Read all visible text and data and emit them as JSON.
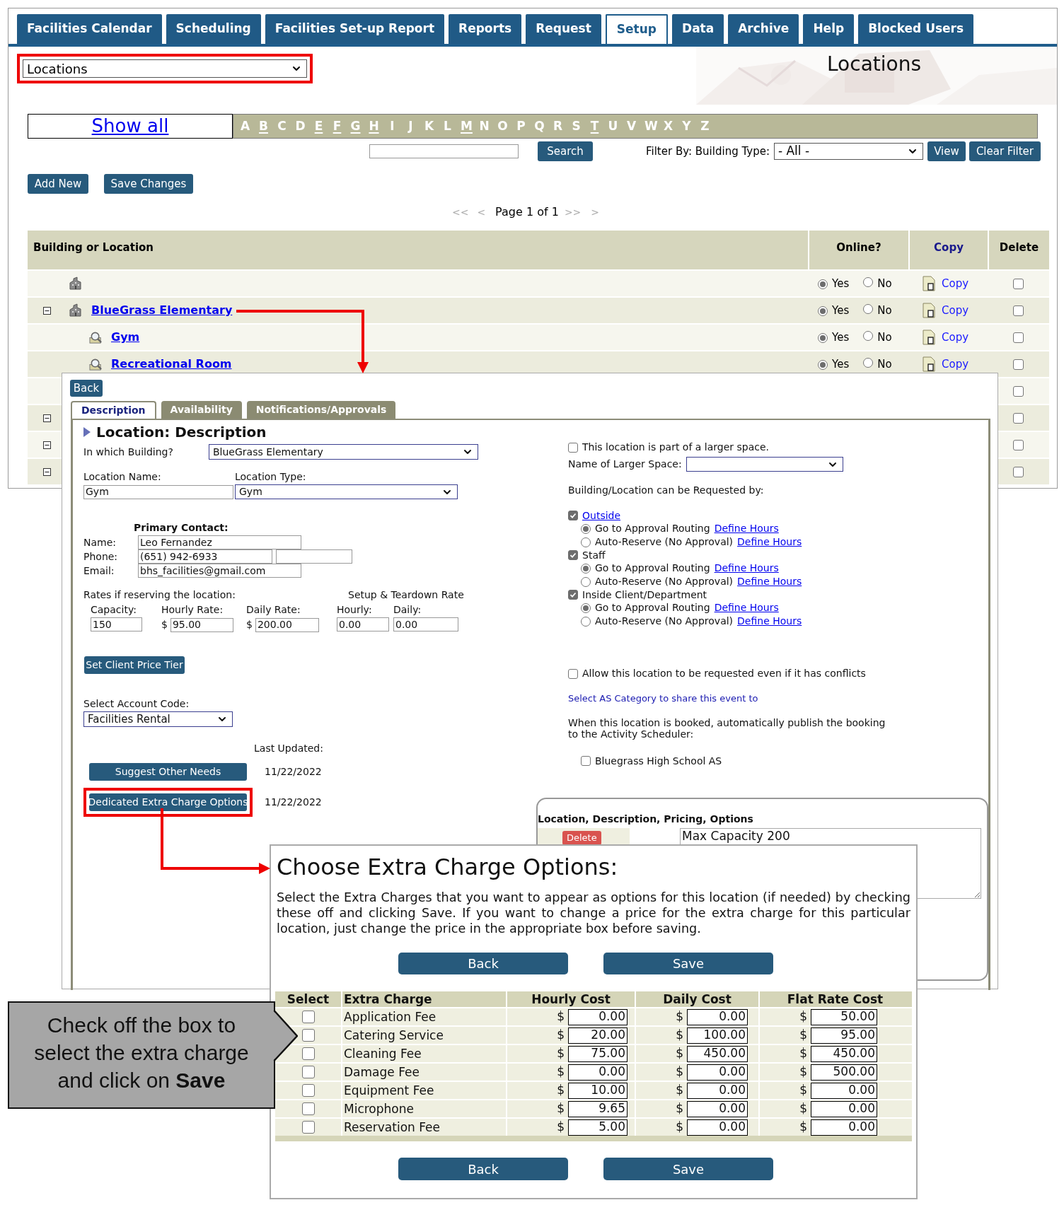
{
  "nav_tabs": [
    {
      "label": "Facilities Calendar",
      "selected": false
    },
    {
      "label": "Scheduling",
      "selected": false
    },
    {
      "label": "Facilities Set-up Report",
      "selected": false
    },
    {
      "label": "Reports",
      "selected": false
    },
    {
      "label": "Request",
      "selected": false
    },
    {
      "label": "Setup",
      "selected": true
    },
    {
      "label": "Data",
      "selected": false
    },
    {
      "label": "Archive",
      "selected": false
    },
    {
      "label": "Help",
      "selected": false
    },
    {
      "label": "Blocked Users",
      "selected": false
    }
  ],
  "view_select": {
    "value": "Locations",
    "highlighted": true
  },
  "page_title": "Locations",
  "show_all": "Show all",
  "letters": [
    {
      "letter": "A",
      "linked": false
    },
    {
      "letter": "B",
      "linked": true
    },
    {
      "letter": "C",
      "linked": false
    },
    {
      "letter": "D",
      "linked": false
    },
    {
      "letter": "E",
      "linked": true
    },
    {
      "letter": "F",
      "linked": true
    },
    {
      "letter": "G",
      "linked": true
    },
    {
      "letter": "H",
      "linked": true
    },
    {
      "letter": "I",
      "linked": false
    },
    {
      "letter": "J",
      "linked": false
    },
    {
      "letter": "K",
      "linked": false
    },
    {
      "letter": "L",
      "linked": false
    },
    {
      "letter": "M",
      "linked": true
    },
    {
      "letter": "N",
      "linked": false
    },
    {
      "letter": "O",
      "linked": false
    },
    {
      "letter": "P",
      "linked": false
    },
    {
      "letter": "Q",
      "linked": false
    },
    {
      "letter": "R",
      "linked": false
    },
    {
      "letter": "S",
      "linked": false
    },
    {
      "letter": "T",
      "linked": true
    },
    {
      "letter": "U",
      "linked": false
    },
    {
      "letter": "V",
      "linked": false
    },
    {
      "letter": "W",
      "linked": false
    },
    {
      "letter": "X",
      "linked": false
    },
    {
      "letter": "Y",
      "linked": false
    },
    {
      "letter": "Z",
      "linked": false
    }
  ],
  "search": {
    "button": "Search"
  },
  "filter": {
    "label": "Filter By: Building Type:",
    "value": "- All -",
    "view": "View",
    "clear": "Clear Filter"
  },
  "actions": [
    "Add New",
    "Save Changes"
  ],
  "pager": {
    "first": "<<",
    "prev": "<",
    "label": "Page 1 of 1",
    "next": ">>",
    "last": ">"
  },
  "table": {
    "columns": [
      "Building or Location",
      "Online?",
      "Copy",
      "Delete"
    ],
    "rows": [
      {
        "kind": "building",
        "expander": false,
        "online": true,
        "yes": "Yes",
        "no": "No",
        "copy": "Copy",
        "delete_checked": false
      },
      {
        "kind": "building",
        "expander": true,
        "name": "BlueGrass Elementary",
        "online": true,
        "yes": "Yes",
        "no": "No",
        "copy": "Copy",
        "delete_checked": false
      },
      {
        "kind": "room",
        "expander": false,
        "name": "Gym",
        "online": true,
        "yes": "Yes",
        "no": "No",
        "copy": "Copy",
        "delete_checked": false
      },
      {
        "kind": "room",
        "expander": false,
        "name": "Recreational Room",
        "online": true,
        "yes": "Yes",
        "no": "No",
        "copy": "Copy",
        "delete_checked": false
      },
      {
        "kind": "covered",
        "expander": false,
        "delete_checked": false
      },
      {
        "kind": "covered",
        "expander": true,
        "delete_checked": false
      },
      {
        "kind": "covered",
        "expander": true,
        "delete_checked": false
      },
      {
        "kind": "covered",
        "expander": true,
        "delete_checked": false
      }
    ]
  },
  "location_panel": {
    "back": "Back",
    "tabs": [
      {
        "label": "Description",
        "selected": true
      },
      {
        "label": "Availability",
        "selected": false
      },
      {
        "label": "Notifications/Approvals",
        "selected": false
      }
    ],
    "heading": "Location: Description",
    "building_label": "In which Building?",
    "building_value": "BlueGrass Elementary",
    "name_label": "Location Name:",
    "name_value": "Gym",
    "type_label": "Location Type:",
    "type_value": "Gym",
    "contact_heading": "Primary Contact:",
    "contact": [
      {
        "kind": "text",
        "label": "Name:",
        "value": "Leo Fernandez"
      },
      {
        "kind": "phone",
        "label": "Phone:",
        "value": "(651) 942-6933"
      },
      {
        "kind": "text",
        "label": "Email:",
        "value": "bhs_facilities@gmail.com"
      }
    ],
    "rates_label": "Rates if reserving the location:",
    "setup_label": "Setup & Teardown Rate",
    "rates": [
      {
        "label": "Capacity:",
        "value": "150"
      },
      {
        "label": "Hourly Rate:",
        "currency": "$",
        "value": "95.00"
      },
      {
        "label": "Daily Rate:",
        "currency": "$",
        "value": "200.00"
      },
      {
        "label": "Hourly:",
        "value": "0.00"
      },
      {
        "label": "Daily:",
        "value": "0.00"
      }
    ],
    "price_tier_button": "Set Client Price Tier",
    "account_label": "Select Account Code:",
    "account_value": "Facilities Rental",
    "last_updated_label": "Last Updated:",
    "option_buttons": [
      {
        "label": "Suggest Other Needs",
        "date": "11/22/2022",
        "highlighted": false
      },
      {
        "label": "Dedicated Extra Charge Options",
        "date": "11/22/2022",
        "highlighted": true
      }
    ],
    "larger_space": {
      "checked": false,
      "label": "This location is part of a larger space.",
      "name_label": "Name of Larger Space:"
    },
    "requested_by_label": "Building/Location can be Requested by:",
    "requesters": [
      {
        "label": "Outside",
        "link": true,
        "checked": true,
        "options": [
          {
            "label": "Go to Approval Routing",
            "link": "Define Hours",
            "selected": true
          },
          {
            "label": "Auto-Reserve (No Approval)",
            "link": "Define Hours",
            "selected": false
          }
        ]
      },
      {
        "label": "Staff",
        "link": false,
        "checked": true,
        "options": [
          {
            "label": "Go to Approval Routing",
            "link": "Define Hours",
            "selected": true
          },
          {
            "label": "Auto-Reserve (No Approval)",
            "link": "Define Hours",
            "selected": false
          }
        ]
      },
      {
        "label": "Inside Client/Department",
        "link": false,
        "checked": true,
        "options": [
          {
            "label": "Go to Approval Routing",
            "link": "Define Hours",
            "selected": true
          },
          {
            "label": "Auto-Reserve (No Approval)",
            "link": "Define Hours",
            "selected": false
          }
        ]
      }
    ],
    "allow_conflicts": {
      "checked": false,
      "label": "Allow this location to be requested even if it has conflicts"
    },
    "as_category_link": "Select AS Category to share this event to",
    "publish_text": "When this location is booked, automatically publish the booking to the Activity Scheduler:",
    "scheduler": {
      "checked": false,
      "label": "Bluegrass High School AS"
    },
    "options_box": {
      "title": "Location, Description, Pricing, Options",
      "delete": "Delete",
      "text": "Max Capacity 200"
    }
  },
  "extra_charges": {
    "title": "Choose Extra Charge Options:",
    "intro": "Select the Extra Charges that you want to appear as options for this location (if needed) by checking these off and clicking Save. If you want to change a price for the extra charge for this particular location, just change the price in the appropriate box before saving.",
    "top_buttons": [
      "Back",
      "Save"
    ],
    "columns": [
      "Select",
      "Extra Charge",
      "Hourly Cost",
      "Daily Cost",
      "Flat Rate Cost"
    ],
    "rows": [
      {
        "checked": false,
        "name": "Application Fee",
        "costs": [
          {
            "currency": "$",
            "value": "0.00"
          },
          {
            "currency": "$",
            "value": "0.00"
          },
          {
            "currency": "$",
            "value": "50.00"
          }
        ]
      },
      {
        "checked": false,
        "name": "Catering Service",
        "costs": [
          {
            "currency": "$",
            "value": "20.00"
          },
          {
            "currency": "$",
            "value": "100.00"
          },
          {
            "currency": "$",
            "value": "95.00"
          }
        ]
      },
      {
        "checked": false,
        "name": "Cleaning Fee",
        "costs": [
          {
            "currency": "$",
            "value": "75.00"
          },
          {
            "currency": "$",
            "value": "450.00"
          },
          {
            "currency": "$",
            "value": "450.00"
          }
        ]
      },
      {
        "checked": false,
        "name": "Damage Fee",
        "costs": [
          {
            "currency": "$",
            "value": "0.00"
          },
          {
            "currency": "$",
            "value": "0.00"
          },
          {
            "currency": "$",
            "value": "500.00"
          }
        ]
      },
      {
        "checked": false,
        "name": "Equipment Fee",
        "costs": [
          {
            "currency": "$",
            "value": "10.00"
          },
          {
            "currency": "$",
            "value": "0.00"
          },
          {
            "currency": "$",
            "value": "0.00"
          }
        ]
      },
      {
        "checked": false,
        "name": "Microphone",
        "costs": [
          {
            "currency": "$",
            "value": "9.65"
          },
          {
            "currency": "$",
            "value": "0.00"
          },
          {
            "currency": "$",
            "value": "0.00"
          }
        ]
      },
      {
        "checked": false,
        "name": "Reservation Fee",
        "costs": [
          {
            "currency": "$",
            "value": "5.00"
          },
          {
            "currency": "$",
            "value": "0.00"
          },
          {
            "currency": "$",
            "value": "0.00"
          }
        ]
      }
    ],
    "bottom_buttons": [
      "Back",
      "Save"
    ]
  },
  "callout": {
    "text": "Check off the box to select the extra charge and click on **Save**"
  }
}
